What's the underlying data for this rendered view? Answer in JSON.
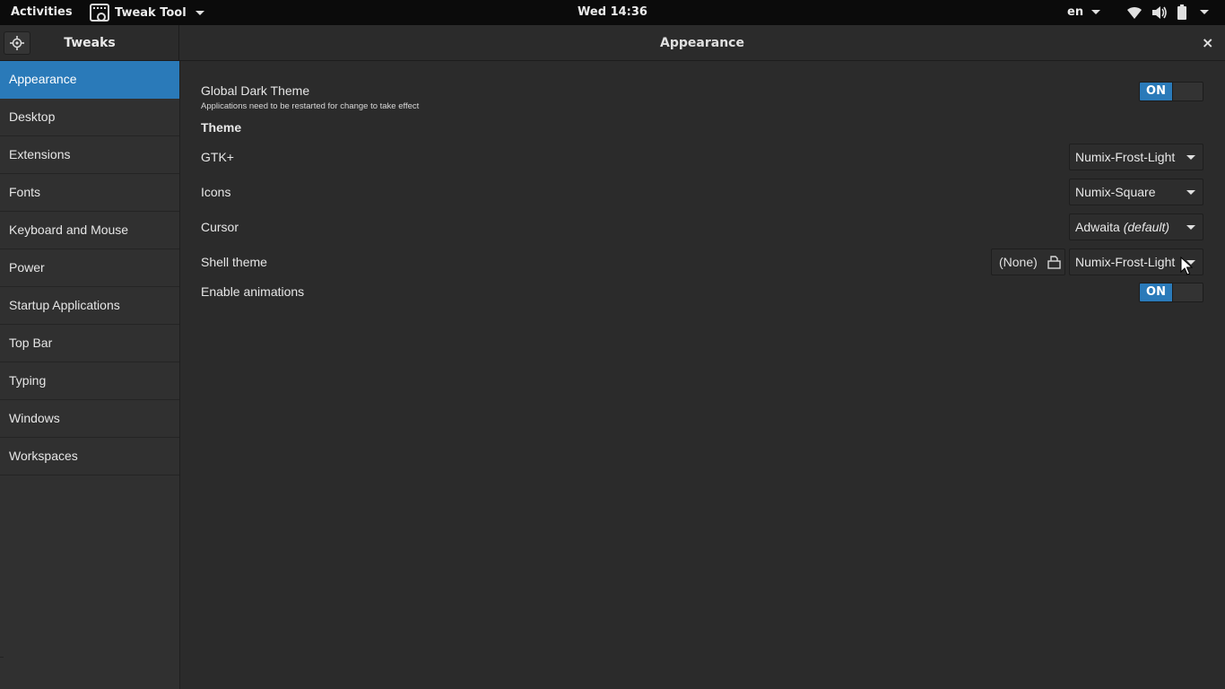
{
  "topbar": {
    "activities": "Activities",
    "app_name": "Tweak Tool",
    "clock": "Wed 14:36",
    "language": "en"
  },
  "header": {
    "sidebar_title": "Tweaks",
    "title": "Appearance",
    "close_glyph": "×"
  },
  "sidebar": {
    "items": [
      {
        "label": "Appearance",
        "active": true
      },
      {
        "label": "Desktop"
      },
      {
        "label": "Extensions"
      },
      {
        "label": "Fonts"
      },
      {
        "label": "Keyboard and Mouse"
      },
      {
        "label": "Power"
      },
      {
        "label": "Startup Applications"
      },
      {
        "label": "Top Bar"
      },
      {
        "label": "Typing"
      },
      {
        "label": "Windows"
      },
      {
        "label": "Workspaces"
      }
    ]
  },
  "main": {
    "global_dark": {
      "label": "Global Dark Theme",
      "note": "Applications need to be restarted for change to take effect",
      "switch": "ON"
    },
    "theme_section": "Theme",
    "gtk": {
      "label": "GTK+",
      "value": "Numix-Frost-Light"
    },
    "icons": {
      "label": "Icons",
      "value": "Numix-Square"
    },
    "cursor": {
      "label": "Cursor",
      "value": "Adwaita",
      "value_suffix": "(default)"
    },
    "shell": {
      "label": "Shell theme",
      "file_value": "(None)",
      "value": "Numix-Frost-Light"
    },
    "animations": {
      "label": "Enable animations",
      "switch": "ON"
    }
  },
  "colors": {
    "accent": "#2a7ab9",
    "topbar_bg": "#0b0b0b",
    "window_bg": "#2b2b2b"
  },
  "icons": [
    "app-icon",
    "wifi-icon",
    "volume-icon",
    "battery-icon",
    "tweak-icon",
    "close-icon",
    "file-open-icon",
    "chevron-down-icon",
    "mouse-cursor"
  ]
}
